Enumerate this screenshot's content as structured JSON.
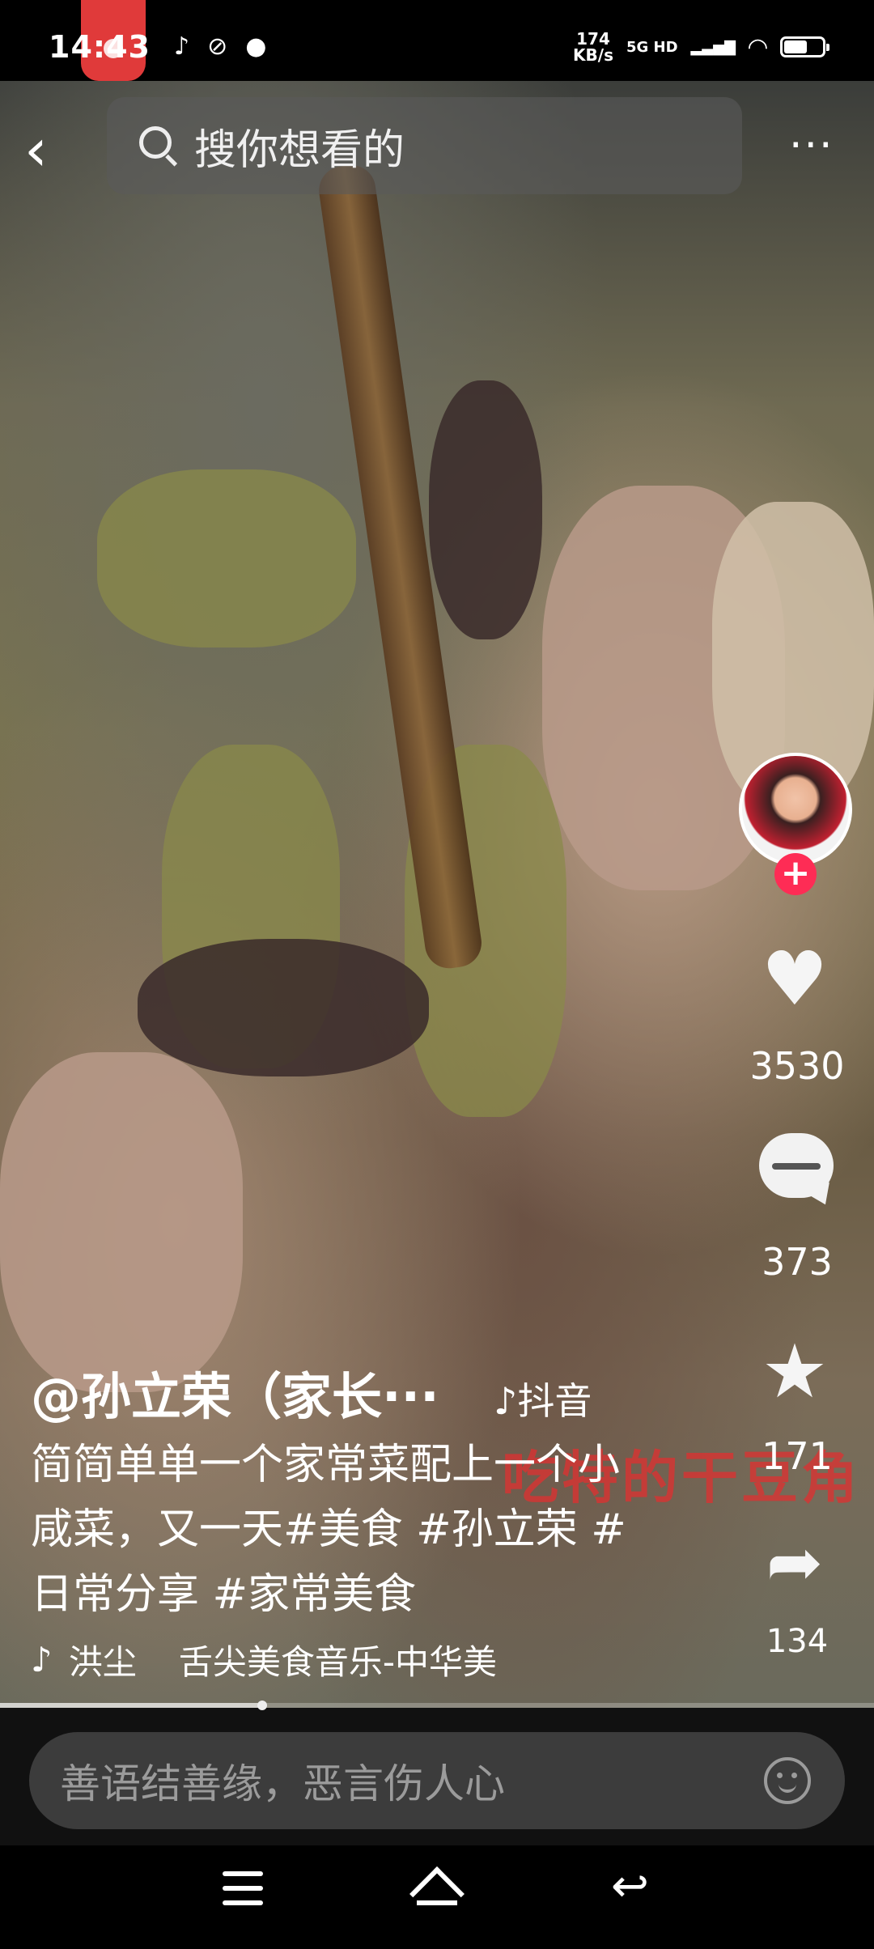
{
  "status_bar": {
    "time": "14:43",
    "net_speed_value": "174",
    "net_speed_unit": "KB/s",
    "network": "5G HD",
    "notification_icons": [
      "tiktok-icon",
      "link-icon",
      "chat-icon"
    ]
  },
  "top_bar": {
    "search_placeholder": "搜你想看的",
    "back_icon": "‹",
    "more_icon": "···"
  },
  "video": {
    "overlay_text": "吃特的干豆角",
    "watermark": "♪抖音"
  },
  "post": {
    "author": "@孙立荣（家长···",
    "description": "简简单单一个家常菜配上一个小咸菜，又一天#美食 #孙立荣 #日常分享 #家常美食",
    "music_artist": "洪尘",
    "music_title": "舌尖美食音乐-中华美"
  },
  "actions": {
    "likes": "3530",
    "comments": "373",
    "favorites": "171",
    "shares": "134"
  },
  "progress": {
    "fraction": 0.3
  },
  "comment_bar": {
    "placeholder": "善语结善缘，恶言伤人心"
  },
  "colors": {
    "accent": "#fe2c55",
    "background": "#000000"
  }
}
